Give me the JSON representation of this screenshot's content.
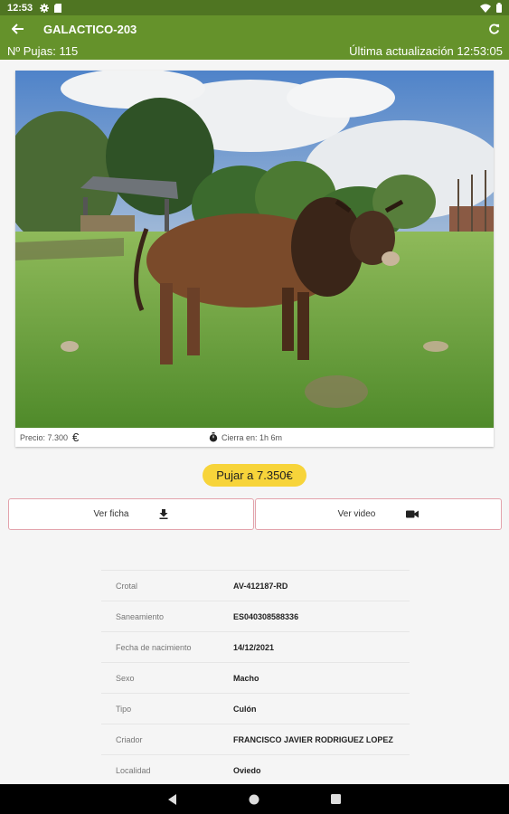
{
  "status_bar": {
    "time": "12:53"
  },
  "app_bar": {
    "title": "GALACTICO-203"
  },
  "sub_bar": {
    "bids": "Nº Pujas: 115",
    "last_update": "Última actualización 12:53:05"
  },
  "listing": {
    "price": "Precio: 7.300",
    "currency_symbol": "€",
    "closes_in": "Cierra en: 1h 6m"
  },
  "actions": {
    "bid_label": "Pujar a 7.350€",
    "sheet_label": "Ver ficha",
    "video_label": "Ver video"
  },
  "details": [
    {
      "label": "Crotal",
      "value": "AV-412187-RD"
    },
    {
      "label": "Saneamiento",
      "value": "ES040308588336"
    },
    {
      "label": "Fecha de nacimiento",
      "value": "14/12/2021"
    },
    {
      "label": "Sexo",
      "value": "Macho"
    },
    {
      "label": "Tipo",
      "value": "Culón"
    },
    {
      "label": "Criador",
      "value": "FRANCISCO JAVIER RODRIGUEZ LOPEZ"
    },
    {
      "label": "Localidad",
      "value": "Oviedo"
    }
  ],
  "colors": {
    "status_bar": "#4f7522",
    "app_bar": "#65922b",
    "bid_button": "#f7d43a",
    "outline_button_border": "#e3a3ac"
  },
  "icons": [
    "settings-icon",
    "sd-card-icon",
    "wifi-icon",
    "battery-icon",
    "back-arrow-icon",
    "refresh-icon",
    "euro-icon",
    "stopwatch-icon",
    "download-icon",
    "video-camera-icon",
    "nav-back-icon",
    "nav-home-icon",
    "nav-recents-icon"
  ]
}
